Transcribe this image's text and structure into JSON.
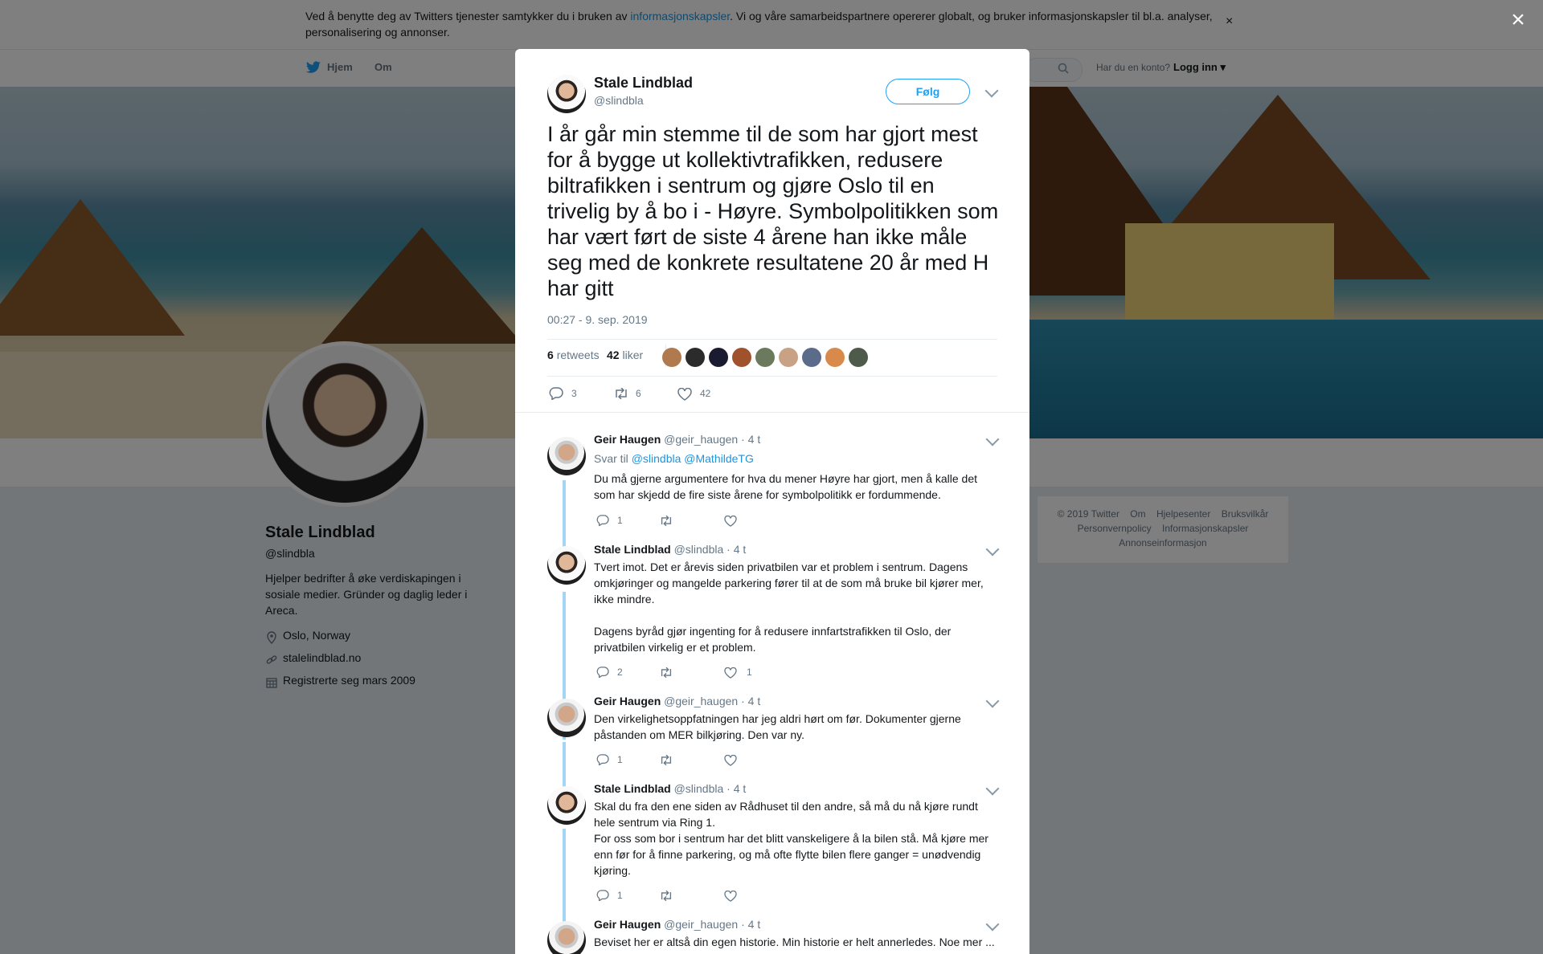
{
  "cookie_banner": {
    "text_before": "Ved å benytte deg av Twitters tjenester samtykker du i bruken av ",
    "link": "informasjonskapsler",
    "text_after": ". Vi og våre samarbeidspartnere opererer globalt, og bruker informasjonskapsler til bl.a. analyser, personalisering og annonser.",
    "close": "×"
  },
  "topnav": {
    "home": "Hjem",
    "about": "Om",
    "account_prompt": "Har du en konto?",
    "login": "Logg inn"
  },
  "overlay_close": "×",
  "profile": {
    "name": "Stale Lindblad",
    "handle": "@slindbla",
    "bio": "Hjelper bedrifter å øke verdiskapingen i sosiale medier. Gründer og daglig leder i Areca.",
    "location": "Oslo, Norway",
    "website": "stalelindblad.no",
    "joined": "Registrerte seg mars 2009"
  },
  "footer": {
    "line1": [
      "© 2019 Twitter",
      "Om",
      "Hjelpesenter",
      "Bruksvilkår"
    ],
    "line2": [
      "Personvernpolicy",
      "Informasjonskapsler"
    ],
    "line3": "Annonseinformasjon"
  },
  "tweet": {
    "author_name": "Stale Lindblad",
    "author_handle": "@slindbla",
    "follow_label": "Følg",
    "text": "I år går min stemme til de som har gjort mest for å bygge ut kollektivtrafikken, redusere biltrafikken i sentrum og gjøre Oslo til en trivelig by å bo i - Høyre. Symbolpolitikken som har vært ført de siste 4 årene han ikke måle seg med de konkrete resultatene 20 år med H har gitt",
    "timestamp": "00:27 - 9. sep. 2019",
    "retweets_count": "6",
    "retweets_label": "retweets",
    "likes_count": "42",
    "likes_label": "liker",
    "reply_action_count": "3",
    "retweet_action_count": "6",
    "like_action_count": "42"
  },
  "replies": [
    {
      "name": "Geir Haugen",
      "handle": "@geir_haugen",
      "time": "· 4 t",
      "reply_to_label": "Svar til",
      "reply_to": "@slindbla @MathildeTG",
      "text": "Du må gjerne argumentere for hva du mener Høyre har gjort, men å kalle det som har skjedd de fire siste årene for symbolpolitikk er fordummende.",
      "replies": "1",
      "retweets": "",
      "likes": ""
    },
    {
      "name": "Stale Lindblad",
      "handle": "@slindbla",
      "time": "· 4 t",
      "text": "Tvert imot. Det er årevis siden privatbilen var et problem i sentrum. Dagens omkjøringer og mangelde parkering fører til at de som må bruke bil kjører mer, ikke mindre.\n\nDagens byråd gjør ingenting for å redusere innfartstrafikken til Oslo, der privatbilen virkelig er et problem.",
      "replies": "2",
      "retweets": "",
      "likes": "1"
    },
    {
      "name": "Geir Haugen",
      "handle": "@geir_haugen",
      "time": "· 4 t",
      "text": "Den virkelighetsoppfatningen har jeg aldri hørt om før. Dokumenter gjerne påstanden om MER bilkjøring. Den var ny.",
      "replies": "1",
      "retweets": "",
      "likes": ""
    },
    {
      "name": "Stale Lindblad",
      "handle": "@slindbla",
      "time": "· 4 t",
      "text": "Skal du fra den ene siden av Rådhuset til den andre, så må du nå kjøre rundt hele sentrum via Ring 1.\nFor oss som bor i sentrum har det blitt vanskeligere å la bilen stå. Må kjøre mer enn før for å finne parkering, og må ofte flytte bilen flere ganger = unødvendig kjøring.",
      "replies": "1",
      "retweets": "",
      "likes": ""
    },
    {
      "name": "Geir Haugen",
      "handle": "@geir_haugen",
      "time": "· 4 t",
      "text": "Beviset her er altså din egen historie. Min historie er helt annerledes. Noe mer ..."
    }
  ],
  "colors": {
    "link_blue": "#1b95e0",
    "twitter_blue": "#1da1f2",
    "thread_line": "#a3d6f5",
    "muted_text": "#657786"
  }
}
